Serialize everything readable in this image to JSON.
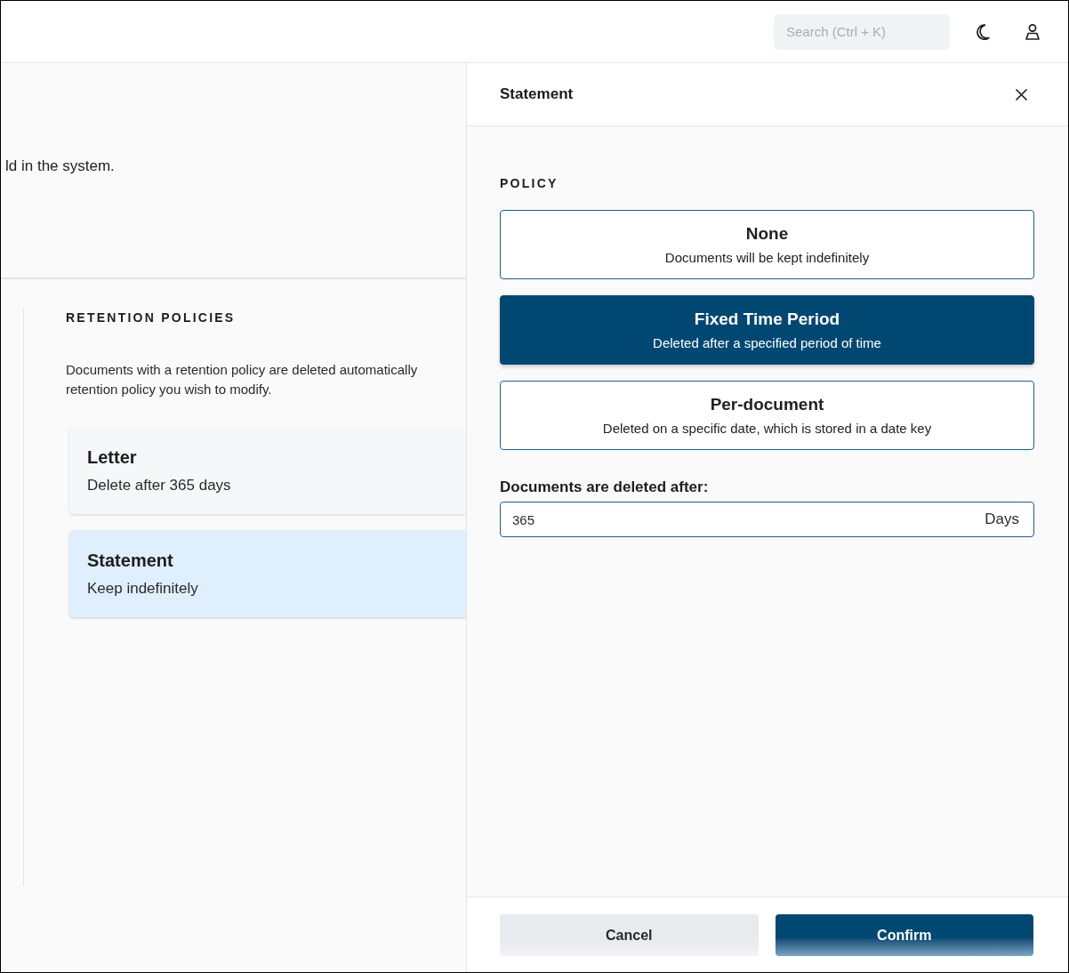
{
  "header": {
    "search": {
      "placeholder": "Search (Ctrl + K)"
    }
  },
  "page": {
    "intro_fragment": "ld in the system.",
    "section_title": "RETENTION POLICIES",
    "description_lines": [
      "Documents with a retention policy are deleted automatically",
      "retention policy you wish to modify."
    ],
    "policies": [
      {
        "name": "Letter",
        "summary": "Delete after 365 days",
        "selected": false
      },
      {
        "name": "Statement",
        "summary": "Keep indefinitely",
        "selected": true
      }
    ]
  },
  "drawer": {
    "title": "Statement",
    "section_label": "POLICY",
    "options": [
      {
        "title": "None",
        "description": "Documents will be kept indefinitely",
        "selected": false
      },
      {
        "title": "Fixed Time Period",
        "description": "Deleted after a specified period of time",
        "selected": true
      },
      {
        "title": "Per-document",
        "description": "Deleted on a specific date, which is stored in a date key",
        "selected": false
      }
    ],
    "duration": {
      "label": "Documents are deleted after:",
      "value": "365",
      "unit": "Days"
    },
    "buttons": [
      {
        "label": "Cancel",
        "kind": "secondary"
      },
      {
        "label": "Confirm",
        "kind": "primary"
      }
    ]
  }
}
